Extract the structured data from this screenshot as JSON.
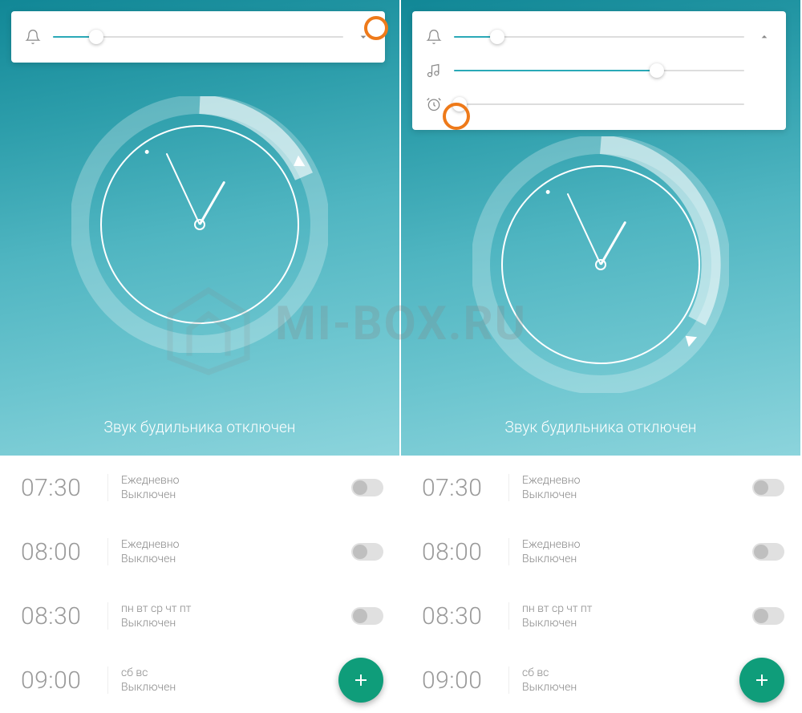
{
  "watermark_text": "MI-BOX.RU",
  "clock_status": "Звук будильника отключен",
  "left": {
    "volume_sliders": [
      {
        "icon": "bell",
        "pct": 15
      }
    ],
    "expand_direction": "down",
    "highlight": "expand-button",
    "clock": {
      "hour_rotation": 30,
      "minute_rotation": -25,
      "tick_dot_angle": -36,
      "alarm_marker_angle": 58
    },
    "alarms": [
      {
        "time": "07:30",
        "repeat": "Ежедневно",
        "state": "Выключен",
        "on": false
      },
      {
        "time": "08:00",
        "repeat": "Ежедневно",
        "state": "Выключен",
        "on": false
      },
      {
        "time": "08:30",
        "repeat": "пн вт ср чт пт",
        "state": "Выключен",
        "on": false
      },
      {
        "time": "09:00",
        "repeat": "сб вс",
        "state": "Выключен",
        "on": false,
        "fab": true
      }
    ]
  },
  "right": {
    "volume_sliders": [
      {
        "icon": "bell",
        "pct": 15
      },
      {
        "icon": "music",
        "pct": 70
      },
      {
        "icon": "alarm-clock",
        "pct": 2
      }
    ],
    "expand_direction": "up",
    "highlight": "alarm-slider-thumb",
    "clock": {
      "hour_rotation": 30,
      "minute_rotation": -25,
      "tick_dot_angle": -36,
      "alarm_marker_angle": 130
    },
    "alarms": [
      {
        "time": "07:30",
        "repeat": "Ежедневно",
        "state": "Выключен",
        "on": false
      },
      {
        "time": "08:00",
        "repeat": "Ежедневно",
        "state": "Выключен",
        "on": false
      },
      {
        "time": "08:30",
        "repeat": "пн вт ср чт пт",
        "state": "Выключен",
        "on": false
      },
      {
        "time": "09:00",
        "repeat": "сб вс",
        "state": "Выключен",
        "on": false,
        "fab": true
      }
    ]
  }
}
